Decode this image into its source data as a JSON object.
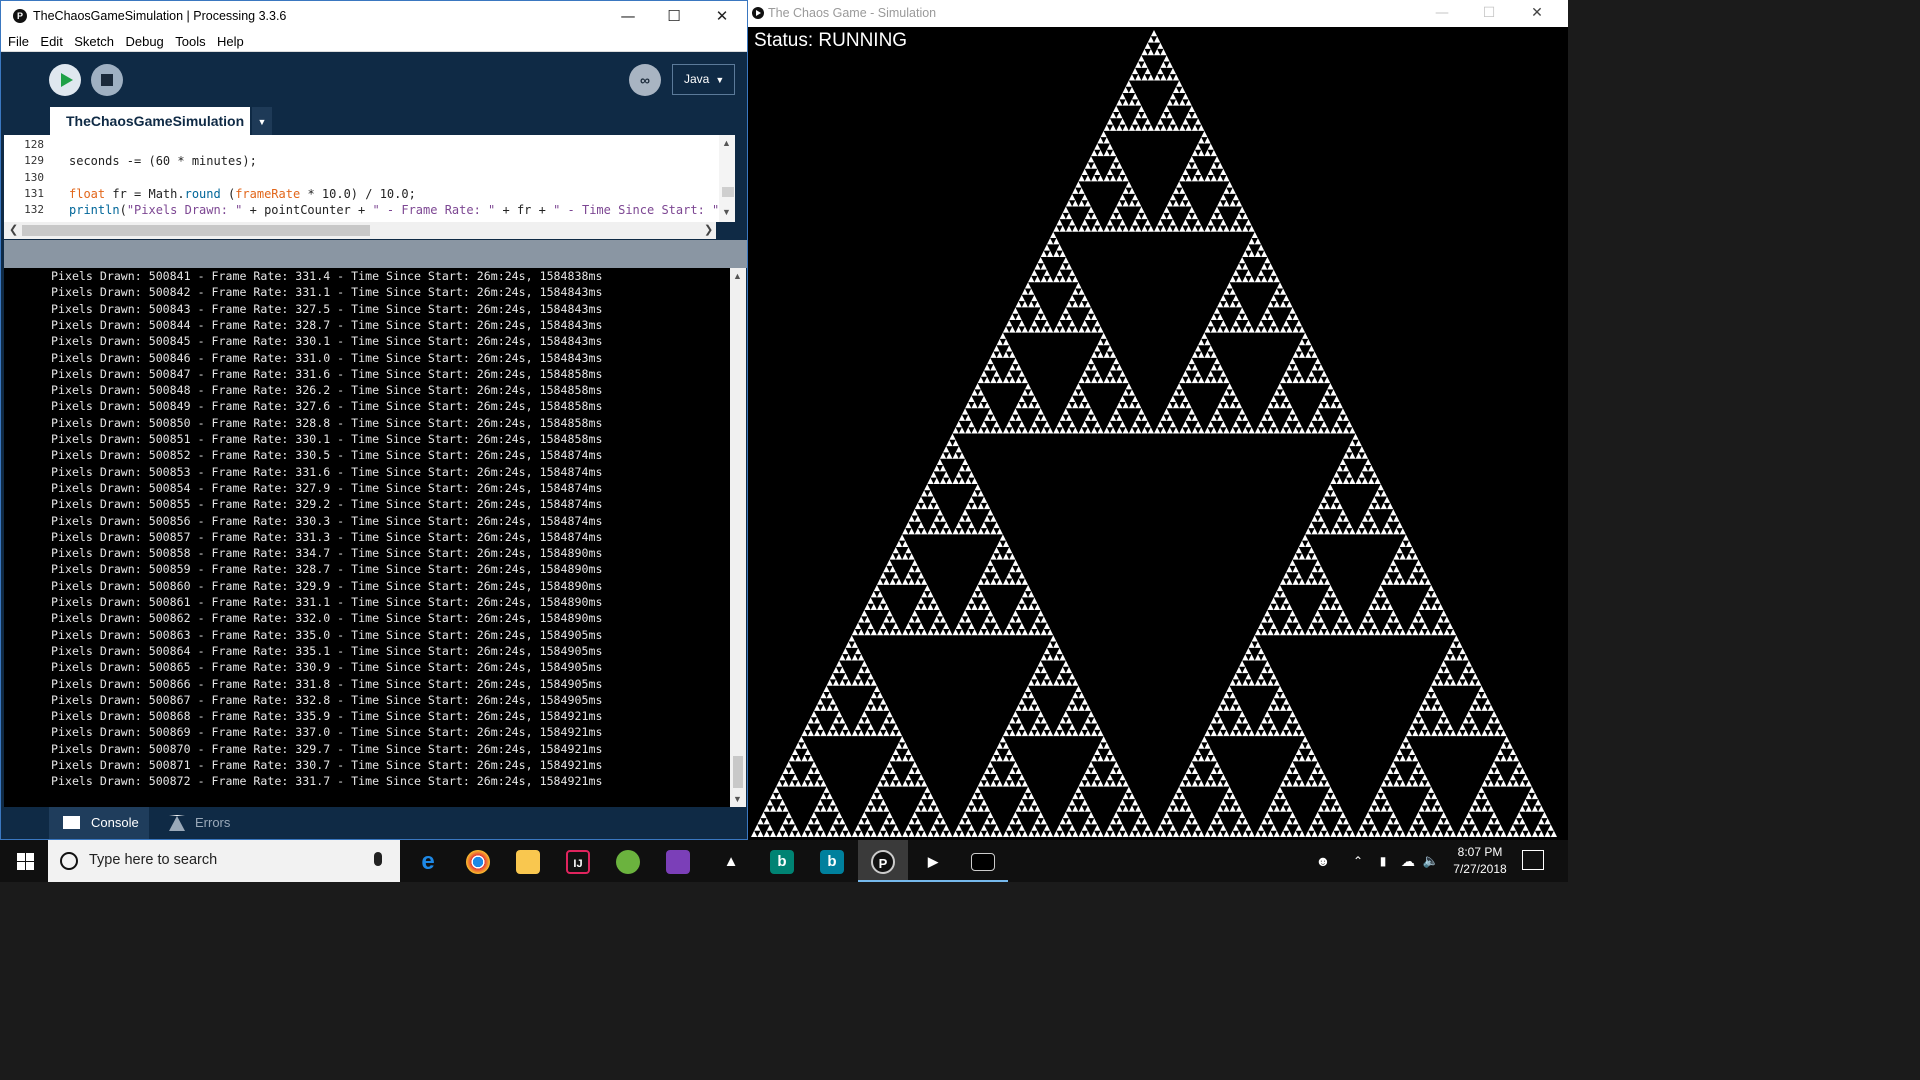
{
  "ide": {
    "title": "TheChaosGameSimulation | Processing 3.3.6",
    "menu": [
      "File",
      "Edit",
      "Sketch",
      "Debug",
      "Tools",
      "Help"
    ],
    "mode": "Java",
    "tab_name": "TheChaosGameSimulation",
    "editor_lines": [
      {
        "num": "128",
        "code": ""
      },
      {
        "num": "129",
        "code": "seconds -= (60 * minutes);"
      },
      {
        "num": "130",
        "code": ""
      },
      {
        "num": "131",
        "code": "float fr = Math.round (frameRate * 10.0) / 10.0;"
      },
      {
        "num": "132",
        "code": "println(\"Pixels Drawn: \" + pointCounter + \" - Frame Rate: \" + fr + \" - Time Since Start: \" + minu"
      }
    ],
    "console_lines": [
      "Pixels Drawn: 500841 - Frame Rate: 331.4 - Time Since Start: 26m:24s, 1584838ms",
      "Pixels Drawn: 500842 - Frame Rate: 331.1 - Time Since Start: 26m:24s, 1584843ms",
      "Pixels Drawn: 500843 - Frame Rate: 327.5 - Time Since Start: 26m:24s, 1584843ms",
      "Pixels Drawn: 500844 - Frame Rate: 328.7 - Time Since Start: 26m:24s, 1584843ms",
      "Pixels Drawn: 500845 - Frame Rate: 330.1 - Time Since Start: 26m:24s, 1584843ms",
      "Pixels Drawn: 500846 - Frame Rate: 331.0 - Time Since Start: 26m:24s, 1584843ms",
      "Pixels Drawn: 500847 - Frame Rate: 331.6 - Time Since Start: 26m:24s, 1584858ms",
      "Pixels Drawn: 500848 - Frame Rate: 326.2 - Time Since Start: 26m:24s, 1584858ms",
      "Pixels Drawn: 500849 - Frame Rate: 327.6 - Time Since Start: 26m:24s, 1584858ms",
      "Pixels Drawn: 500850 - Frame Rate: 328.8 - Time Since Start: 26m:24s, 1584858ms",
      "Pixels Drawn: 500851 - Frame Rate: 330.1 - Time Since Start: 26m:24s, 1584858ms",
      "Pixels Drawn: 500852 - Frame Rate: 330.5 - Time Since Start: 26m:24s, 1584874ms",
      "Pixels Drawn: 500853 - Frame Rate: 331.6 - Time Since Start: 26m:24s, 1584874ms",
      "Pixels Drawn: 500854 - Frame Rate: 327.9 - Time Since Start: 26m:24s, 1584874ms",
      "Pixels Drawn: 500855 - Frame Rate: 329.2 - Time Since Start: 26m:24s, 1584874ms",
      "Pixels Drawn: 500856 - Frame Rate: 330.3 - Time Since Start: 26m:24s, 1584874ms",
      "Pixels Drawn: 500857 - Frame Rate: 331.3 - Time Since Start: 26m:24s, 1584874ms",
      "Pixels Drawn: 500858 - Frame Rate: 334.7 - Time Since Start: 26m:24s, 1584890ms",
      "Pixels Drawn: 500859 - Frame Rate: 328.7 - Time Since Start: 26m:24s, 1584890ms",
      "Pixels Drawn: 500860 - Frame Rate: 329.9 - Time Since Start: 26m:24s, 1584890ms",
      "Pixels Drawn: 500861 - Frame Rate: 331.1 - Time Since Start: 26m:24s, 1584890ms",
      "Pixels Drawn: 500862 - Frame Rate: 332.0 - Time Since Start: 26m:24s, 1584890ms",
      "Pixels Drawn: 500863 - Frame Rate: 335.0 - Time Since Start: 26m:24s, 1584905ms",
      "Pixels Drawn: 500864 - Frame Rate: 335.1 - Time Since Start: 26m:24s, 1584905ms",
      "Pixels Drawn: 500865 - Frame Rate: 330.9 - Time Since Start: 26m:24s, 1584905ms",
      "Pixels Drawn: 500866 - Frame Rate: 331.8 - Time Since Start: 26m:24s, 1584905ms",
      "Pixels Drawn: 500867 - Frame Rate: 332.8 - Time Since Start: 26m:24s, 1584905ms",
      "Pixels Drawn: 500868 - Frame Rate: 335.9 - Time Since Start: 26m:24s, 1584921ms",
      "Pixels Drawn: 500869 - Frame Rate: 337.0 - Time Since Start: 26m:24s, 1584921ms",
      "Pixels Drawn: 500870 - Frame Rate: 329.7 - Time Since Start: 26m:24s, 1584921ms",
      "Pixels Drawn: 500871 - Frame Rate: 330.7 - Time Since Start: 26m:24s, 1584921ms",
      "Pixels Drawn: 500872 - Frame Rate: 331.7 - Time Since Start: 26m:24s, 1584921ms"
    ],
    "console_tab": "Console",
    "errors_tab": "Errors"
  },
  "sim": {
    "title": "The Chaos Game - Simulation",
    "status": "Status: RUNNING",
    "fractal_levels": 7
  },
  "taskbar": {
    "search_placeholder": "Type here to search",
    "time": "8:07 PM",
    "date": "7/27/2018",
    "apps": [
      "edge-icon",
      "chrome-icon",
      "file-explorer-icon",
      "intellij-icon",
      "android-studio-icon",
      "visual-studio-icon",
      "unity-icon",
      "bing-icon",
      "bing-icon",
      "processing-icon",
      "processing-sketch-icon",
      "terminal-icon"
    ]
  },
  "colors": {
    "ide_background": "#0f2a45",
    "console_background": "#000000",
    "keyword": "#e2661a",
    "string": "#7d4793",
    "run_green": "#1ea046",
    "taskbar": "#101010"
  }
}
